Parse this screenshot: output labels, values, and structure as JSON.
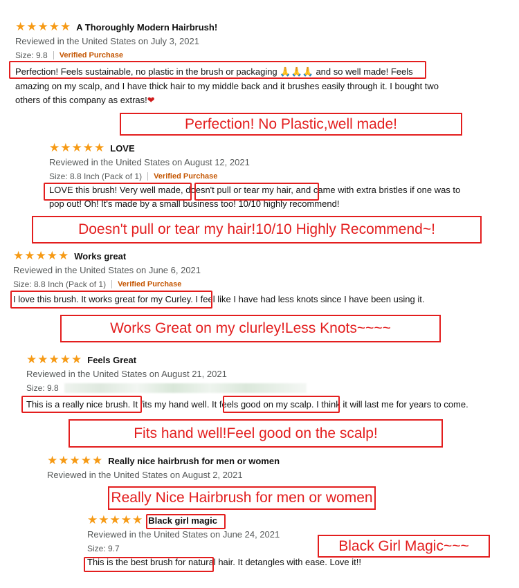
{
  "reviews": [
    {
      "title": "A Thoroughly Modern Hairbrush!",
      "date": "Reviewed in the United States on July 3, 2021",
      "size": "Size: 9.8",
      "verified": "Verified Purchase",
      "body_l1_a": "Perfection! Feels sustainable, no plastic in the brush or packaging ",
      "body_l1_b": " and so well made! Feels",
      "body_l2": "amazing on my scalp, and I have thick hair to my middle back and it brushes easily through it. I bought two",
      "body_l3": "others of this company as extras!",
      "note": "Perfection! No Plastic,well made!"
    },
    {
      "title": "LOVE",
      "date": "Reviewed in the United States on August 12, 2021",
      "size": "Size: 8.8 Inch (Pack of 1)",
      "verified": "Verified Purchase",
      "body_l1": "LOVE this brush! Very well made, doesn't pull or tear my hair, and came with extra bristles if one was to",
      "body_l2": "pop out! Oh! It's made by a small business too! 10/10 highly recommend!",
      "note": "Doesn't pull or tear my hair!10/10 Highly Recommend~!"
    },
    {
      "title": "Works great",
      "date": "Reviewed in the United States on June 6, 2021",
      "size": "Size: 8.8 Inch (Pack of 1)",
      "verified": "Verified Purchase",
      "body_l1": "I love this brush. It works great for my Curley. I feel like I have had less knots since I have been using it.",
      "note": "Works Great on my clurley!Less Knots~~~~"
    },
    {
      "title": "Feels Great",
      "date": "Reviewed in the United States on August 21, 2021",
      "size": "Size: 9.8",
      "body_l1": "This is a really nice brush. It fits my hand well. It feels good on my scalp. I think it will last me for years to come.",
      "note": "Fits hand well!Feel good on the scalp!"
    },
    {
      "title": "Really nice hairbrush for men or women",
      "date": "Reviewed in the United States on August 2, 2021",
      "note": "Really Nice Hairbrush for men or women"
    },
    {
      "title": "Black girl magic",
      "date": "Reviewed in the United States on June 24, 2021",
      "size": "Size: 9.7",
      "body_l1": "This is the best brush for natural hair. It detangles with ease. Love it!!",
      "note": "Black Girl Magic~~~"
    }
  ],
  "rating": 5,
  "rating_max": 5,
  "colors": {
    "star": "#F69A15",
    "verified": "#C45500",
    "annotation": "#e31e1e",
    "meta": "#565959"
  },
  "icons": {
    "star": "star-icon",
    "praying_hands": "praying-hands-icon",
    "heart": "heart-icon"
  }
}
